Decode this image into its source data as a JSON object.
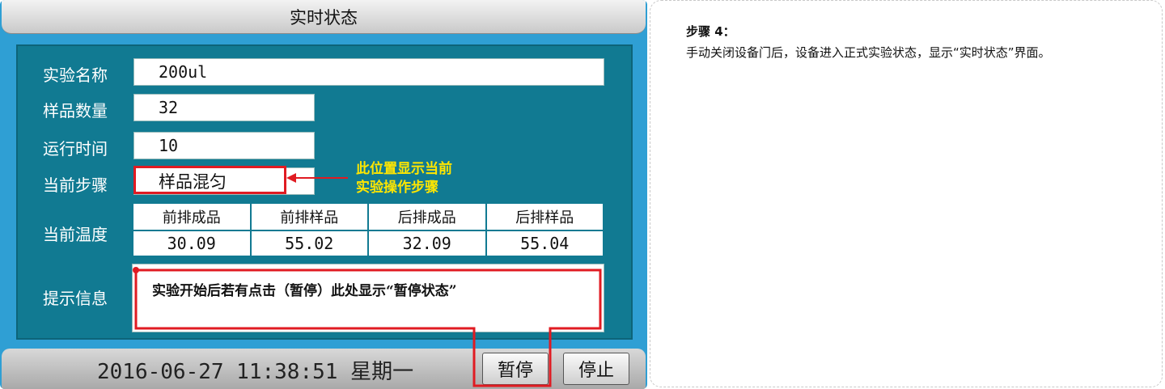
{
  "screen": {
    "title": "实时状态",
    "fields": {
      "experiment_name_label": "实验名称",
      "experiment_name_value": "200ul",
      "sample_count_label": "样品数量",
      "sample_count_value": "32",
      "run_time_label": "运行时间",
      "run_time_value": "10",
      "current_step_label": "当前步骤",
      "current_step_value": "样品混匀"
    },
    "temperature": {
      "label": "当前温度",
      "columns": [
        "前排成品",
        "前排样品",
        "后排成品",
        "后排样品"
      ],
      "values": [
        "30.09",
        "55.02",
        "32.09",
        "55.04"
      ]
    },
    "hint": {
      "label": "提示信息",
      "text": "实验开始后若有点击（暂停）此处显示“暂停状态”"
    },
    "annotation": {
      "line1": "此位置显示当前",
      "line2": "实验操作步骤"
    },
    "status_bar": {
      "datetime": "2016-06-27 11:38:51",
      "weekday": "星期一",
      "pause_button": "暂停",
      "stop_button": "停止"
    }
  },
  "step": {
    "title": "步骤 4：",
    "description": "手动关闭设备门后，设备进入正式实验状态，显示“实时状态”界面。"
  },
  "colors": {
    "panel": "#117a92",
    "device": "#2f9fd4",
    "highlight": "#e01b22",
    "annotation": "#ffe600"
  }
}
